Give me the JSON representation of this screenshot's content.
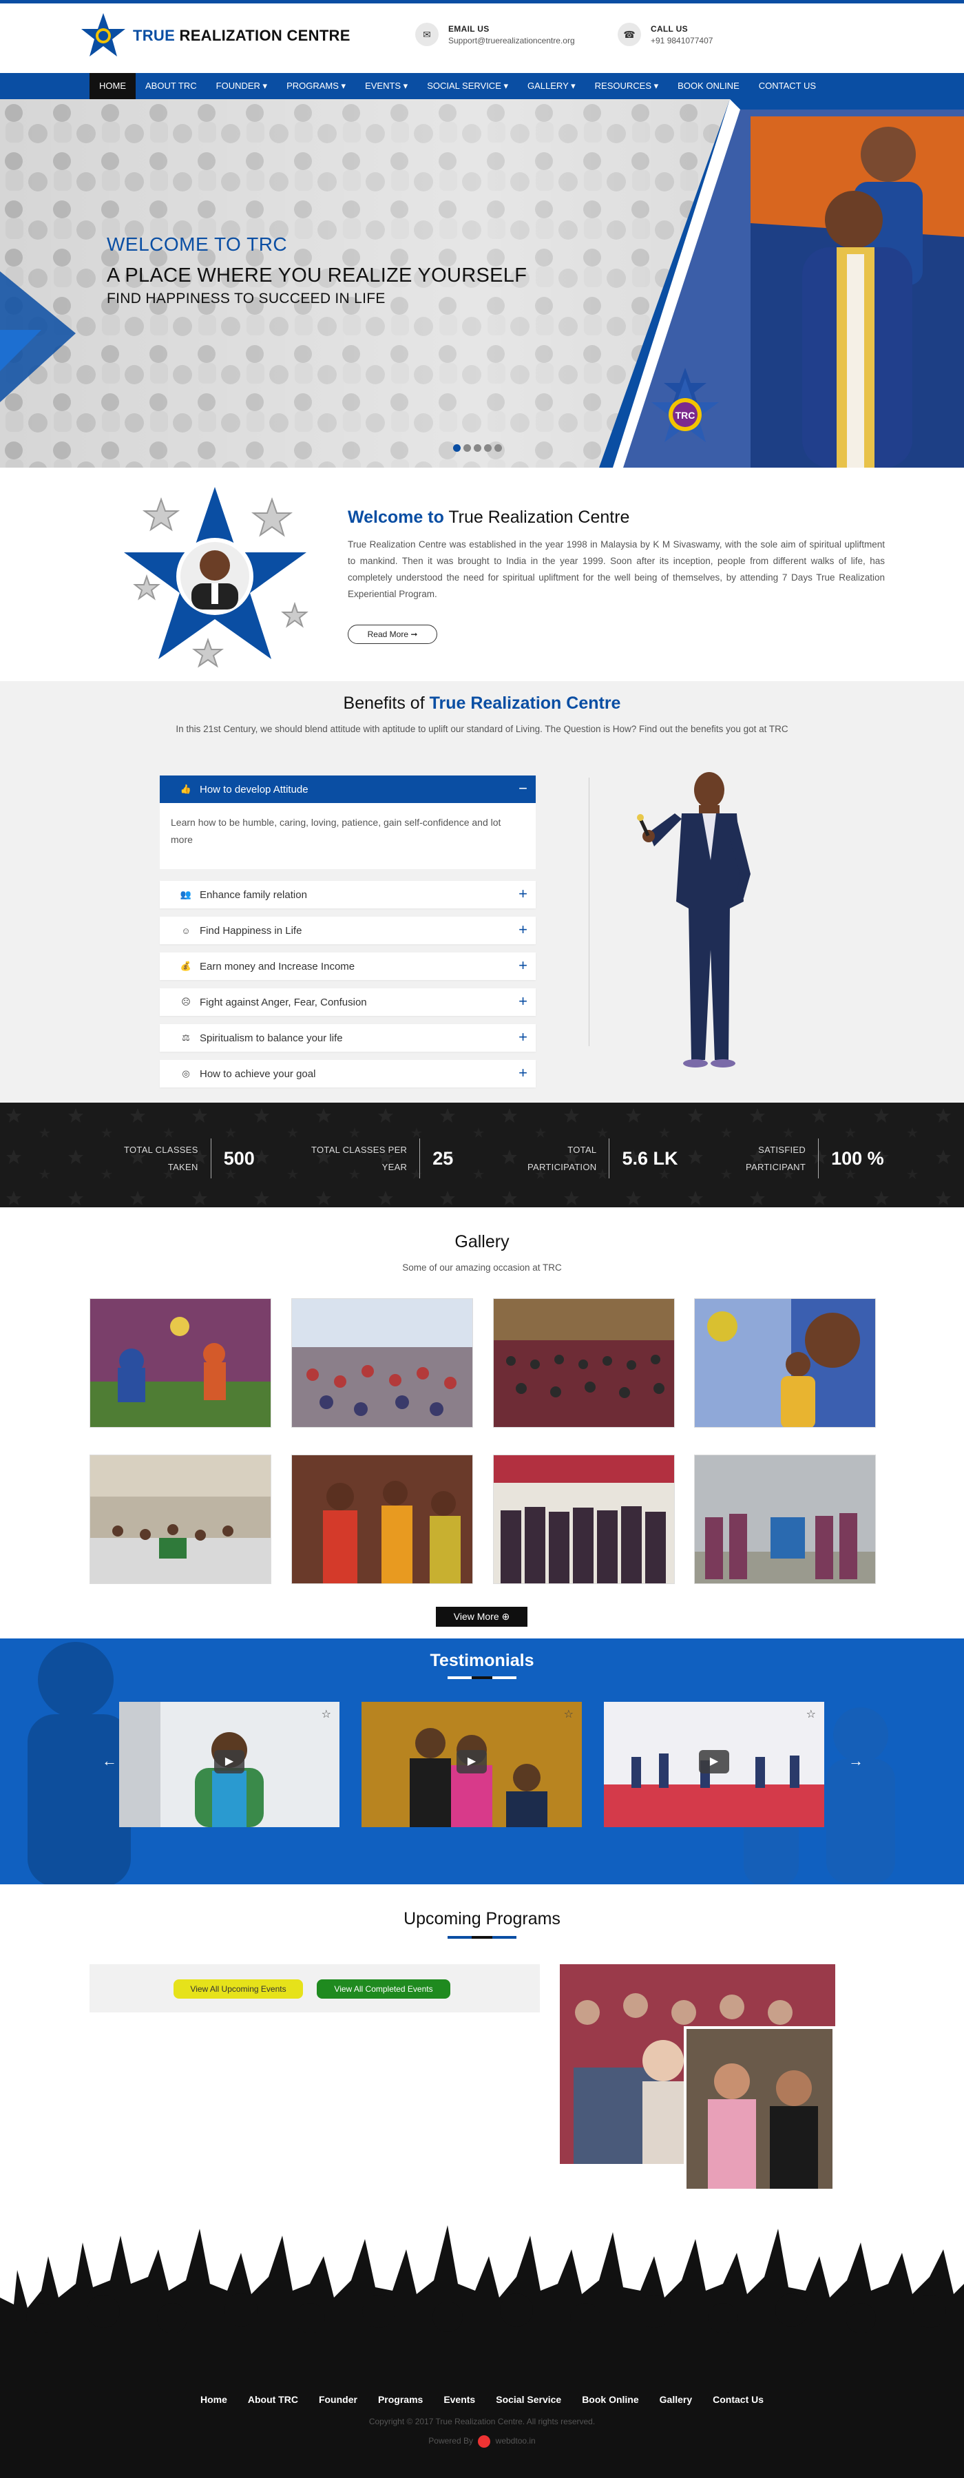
{
  "header": {
    "logo_text_blue": "TRUE",
    "logo_text_dark": "REALIZATION CENTRE",
    "email_label": "EMAIL US",
    "email_value": "Support@truerealizationcentre.org",
    "call_label": "CALL US",
    "call_value": "+91 9841077407"
  },
  "nav": {
    "items": [
      "HOME",
      "ABOUT TRC",
      "FOUNDER ▾",
      "PROGRAMS ▾",
      "EVENTS ▾",
      "SOCIAL SERVICE ▾",
      "GALLERY ▾",
      "RESOURCES ▾",
      "BOOK ONLINE",
      "CONTACT US"
    ],
    "active": "HOME"
  },
  "hero": {
    "line1": "WELCOME TO TRC",
    "line2": "A PLACE WHERE YOU REALIZE YOURSELF",
    "line3": "FIND HAPPINESS TO SUCCEED IN LIFE",
    "badge": "TRC",
    "slide_count": 5,
    "active_slide": 1
  },
  "welcome": {
    "title_prefix": "Welcome to",
    "title_rest": " True Realization Centre",
    "body": "True Realization Centre was established in the year 1998 in Malaysia by K M Sivaswamy, with the sole aim of spiritual upliftment to mankind. Then it was brought to India in the year 1999. Soon after its inception, people from different walks of life, has completely understood the need for spiritual upliftment for the well being of themselves, by attending 7 Days True Realization Experiential Program.",
    "read_more": "Read More ➞"
  },
  "benefits": {
    "title_prefix": "Benefits of ",
    "title_highlight": "True Realization Centre",
    "intro": "In this 21st Century, we should blend attitude with aptitude to uplift our standard of Living. The Question is How? Find out the benefits you got at TRC",
    "items": [
      {
        "label": "How to develop Attitude",
        "icon": "thumbs-up-icon",
        "glyph": "👍",
        "toggle": "−",
        "open": true,
        "body": "Learn how to be humble, caring, loving, patience, gain self-confidence and lot more"
      },
      {
        "label": "Enhance family relation",
        "icon": "users-icon",
        "glyph": "👥",
        "toggle": "+"
      },
      {
        "label": "Find Happiness in Life",
        "icon": "smile-icon",
        "glyph": "☺",
        "toggle": "+"
      },
      {
        "label": "Earn money and Increase Income",
        "icon": "money-bag-icon",
        "glyph": "💰",
        "toggle": "+"
      },
      {
        "label": "Fight against Anger, Fear, Confusion",
        "icon": "frown-icon",
        "glyph": "☹",
        "toggle": "+"
      },
      {
        "label": "Spiritualism to balance your life",
        "icon": "balance-icon",
        "glyph": "⚖",
        "toggle": "+"
      },
      {
        "label": "How to achieve your goal",
        "icon": "target-icon",
        "glyph": "◎",
        "toggle": "+"
      }
    ]
  },
  "stats": [
    {
      "label_line1": "TOTAL CLASSES",
      "label_line2": "TAKEN",
      "value": "500"
    },
    {
      "label_line1": "TOTAL CLASSES PER",
      "label_line2": "YEAR",
      "value": "25"
    },
    {
      "label_line1": "TOTAL",
      "label_line2": "PARTICIPATION",
      "value": "5.6 LK"
    },
    {
      "label_line1": "SATISFIED",
      "label_line2": "PARTICIPANT",
      "value": "100 %"
    }
  ],
  "gallery": {
    "title": "Gallery",
    "subtitle": "Some of our amazing occasion at TRC",
    "view_more": "View More ⊕",
    "photos": [
      "stage-event-photo",
      "audience-photo-1",
      "audience-photo-2",
      "speaker-banner-photo",
      "hall-photo",
      "ceremony-photo",
      "group-photo",
      "outdoor-group-photo"
    ]
  },
  "testimonials": {
    "title": "Testimonials",
    "prev_arrow": "←",
    "next_arrow": "→",
    "play_glyph": "▶",
    "fav_glyph": "☆",
    "videos": [
      "testimonial-video-1",
      "testimonial-video-2",
      "testimonial-video-3"
    ]
  },
  "programs": {
    "title": "Upcoming Programs",
    "btn_upcoming": "View All Upcoming Events",
    "btn_completed": "View All Completed Events"
  },
  "footer": {
    "links": [
      "Home",
      "About TRC",
      "Founder",
      "Programs",
      "Events",
      "Social Service",
      "Book Online",
      "Gallery",
      "Contact Us"
    ],
    "copyright": "Copyright © 2017 True Realization Centre. All rights reserved.",
    "powered_prefix": "Powered By",
    "powered_name": "webdtoo.in"
  },
  "colors": {
    "brand_blue": "#0a4ea3",
    "dark": "#111111",
    "upcoming_btn": "#e6e21a",
    "completed_btn": "#1f8a1f"
  }
}
